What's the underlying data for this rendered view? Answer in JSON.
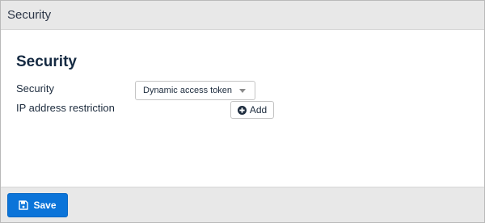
{
  "window": {
    "title": "Security"
  },
  "main": {
    "heading": "Security",
    "security_field": {
      "label": "Security",
      "selected_value": "Dynamic access token"
    },
    "ip_restriction": {
      "label": "IP address restriction",
      "add_label": "Add"
    }
  },
  "footer": {
    "save_label": "Save"
  },
  "icons": {
    "add": "plus-circle-icon",
    "save": "floppy-disk-icon",
    "select": "caret-down-icon"
  },
  "colors": {
    "primary": "#0b74d9",
    "heading": "#152a42",
    "bar_background": "#e8e8e8"
  }
}
